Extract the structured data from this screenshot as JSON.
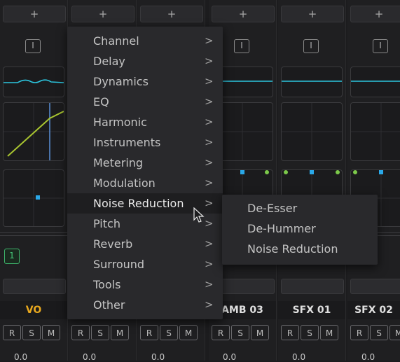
{
  "add_slot_label": "+",
  "insert_label": "I",
  "track_number": "1",
  "rsm": {
    "r": "R",
    "s": "S",
    "m": "M"
  },
  "volume_value": "0.0",
  "tracks": [
    {
      "name": "VO"
    },
    {
      "name": ""
    },
    {
      "name": ""
    },
    {
      "name": "AMB 03"
    },
    {
      "name": "SFX 01"
    },
    {
      "name": "SFX 02"
    }
  ],
  "menu": {
    "items": [
      {
        "label": "Channel",
        "arrow": ">"
      },
      {
        "label": "Delay",
        "arrow": ">"
      },
      {
        "label": "Dynamics",
        "arrow": ">"
      },
      {
        "label": "EQ",
        "arrow": ">"
      },
      {
        "label": "Harmonic",
        "arrow": ">"
      },
      {
        "label": "Instruments",
        "arrow": ">"
      },
      {
        "label": "Metering",
        "arrow": ">"
      },
      {
        "label": "Modulation",
        "arrow": ">"
      },
      {
        "label": "Noise Reduction",
        "arrow": ">"
      },
      {
        "label": "Pitch",
        "arrow": ">"
      },
      {
        "label": "Reverb",
        "arrow": ">"
      },
      {
        "label": "Surround",
        "arrow": ">"
      },
      {
        "label": "Tools",
        "arrow": ">"
      },
      {
        "label": "Other",
        "arrow": ">"
      }
    ],
    "active_index": 8
  },
  "submenu": {
    "items": [
      {
        "label": "De-Esser"
      },
      {
        "label": "De-Hummer"
      },
      {
        "label": "Noise Reduction"
      }
    ]
  },
  "colors": {
    "eq_curve": "#2cc6df",
    "dyn_curve": "#a8c430",
    "dyn_marker": "#5b8fd6",
    "pan_dot": "#2aa8e8",
    "green_dot": "#7cc94a",
    "track_vo": "#e8a81e",
    "track_number_border": "#3db26a"
  }
}
